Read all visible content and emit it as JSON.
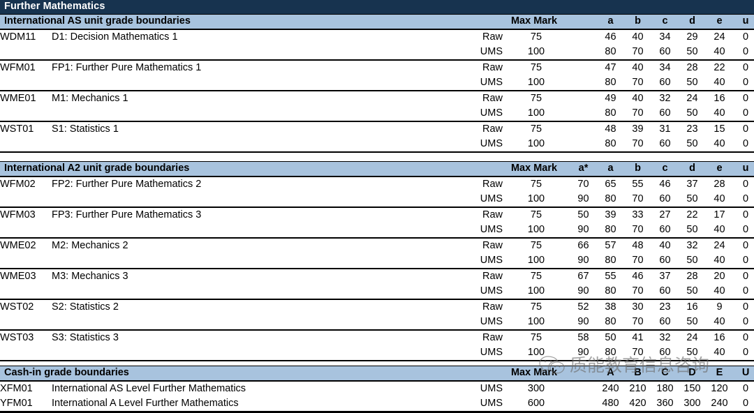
{
  "document": {
    "title": "Further Mathematics"
  },
  "columns": {
    "max_mark": "Max Mark",
    "as_grades": [
      "a",
      "b",
      "c",
      "d",
      "e",
      "u"
    ],
    "a2_grades": [
      "a*",
      "a",
      "b",
      "c",
      "d",
      "e",
      "u"
    ],
    "cashin_grades": [
      "A",
      "B",
      "C",
      "D",
      "E",
      "U"
    ],
    "raw_label": "Raw",
    "ums_label": "UMS"
  },
  "colors": {
    "title_bar": "#17334f",
    "section_bar": "#a8c3de",
    "text": "#000000",
    "watermark": "#6d6d6d"
  },
  "sections": [
    {
      "heading": "International AS unit grade boundaries",
      "units": [
        {
          "code": "WDM11",
          "title": "D1: Decision Mathematics 1",
          "raw": {
            "max": "75",
            "grades": [
              "46",
              "40",
              "34",
              "29",
              "24",
              "0"
            ]
          },
          "ums": {
            "max": "100",
            "grades": [
              "80",
              "70",
              "60",
              "50",
              "40",
              "0"
            ]
          }
        },
        {
          "code": "WFM01",
          "title": "FP1: Further Pure Mathematics 1",
          "raw": {
            "max": "75",
            "grades": [
              "47",
              "40",
              "34",
              "28",
              "22",
              "0"
            ]
          },
          "ums": {
            "max": "100",
            "grades": [
              "80",
              "70",
              "60",
              "50",
              "40",
              "0"
            ]
          }
        },
        {
          "code": "WME01",
          "title": "M1: Mechanics 1",
          "raw": {
            "max": "75",
            "grades": [
              "49",
              "40",
              "32",
              "24",
              "16",
              "0"
            ]
          },
          "ums": {
            "max": "100",
            "grades": [
              "80",
              "70",
              "60",
              "50",
              "40",
              "0"
            ]
          }
        },
        {
          "code": "WST01",
          "title": "S1: Statistics 1",
          "raw": {
            "max": "75",
            "grades": [
              "48",
              "39",
              "31",
              "23",
              "15",
              "0"
            ]
          },
          "ums": {
            "max": "100",
            "grades": [
              "80",
              "70",
              "60",
              "50",
              "40",
              "0"
            ]
          }
        }
      ]
    },
    {
      "heading": "International A2 unit grade boundaries",
      "units": [
        {
          "code": "WFM02",
          "title": "FP2: Further Pure Mathematics 2",
          "raw": {
            "max": "75",
            "grades": [
              "70",
              "65",
              "55",
              "46",
              "37",
              "28",
              "0"
            ]
          },
          "ums": {
            "max": "100",
            "grades": [
              "90",
              "80",
              "70",
              "60",
              "50",
              "40",
              "0"
            ]
          }
        },
        {
          "code": "WFM03",
          "title": "FP3: Further Pure Mathematics 3",
          "raw": {
            "max": "75",
            "grades": [
              "50",
              "39",
              "33",
              "27",
              "22",
              "17",
              "0"
            ]
          },
          "ums": {
            "max": "100",
            "grades": [
              "90",
              "80",
              "70",
              "60",
              "50",
              "40",
              "0"
            ]
          }
        },
        {
          "code": "WME02",
          "title": "M2: Mechanics 2",
          "raw": {
            "max": "75",
            "grades": [
              "66",
              "57",
              "48",
              "40",
              "32",
              "24",
              "0"
            ]
          },
          "ums": {
            "max": "100",
            "grades": [
              "90",
              "80",
              "70",
              "60",
              "50",
              "40",
              "0"
            ]
          }
        },
        {
          "code": "WME03",
          "title": "M3: Mechanics 3",
          "raw": {
            "max": "75",
            "grades": [
              "67",
              "55",
              "46",
              "37",
              "28",
              "20",
              "0"
            ]
          },
          "ums": {
            "max": "100",
            "grades": [
              "90",
              "80",
              "70",
              "60",
              "50",
              "40",
              "0"
            ]
          }
        },
        {
          "code": "WST02",
          "title": "S2: Statistics 2",
          "raw": {
            "max": "75",
            "grades": [
              "52",
              "38",
              "30",
              "23",
              "16",
              "9",
              "0"
            ]
          },
          "ums": {
            "max": "100",
            "grades": [
              "90",
              "80",
              "70",
              "60",
              "50",
              "40",
              "0"
            ]
          }
        },
        {
          "code": "WST03",
          "title": "S3: Statistics 3",
          "raw": {
            "max": "75",
            "grades": [
              "58",
              "50",
              "41",
              "32",
              "24",
              "16",
              "0"
            ]
          },
          "ums": {
            "max": "100",
            "grades": [
              "90",
              "80",
              "70",
              "60",
              "50",
              "40",
              "0"
            ]
          }
        }
      ]
    }
  ],
  "cashin": {
    "heading": "Cash-in grade boundaries",
    "rows": [
      {
        "code": "XFM01",
        "title": "International AS Level Further Mathematics",
        "type": "UMS",
        "max": "300",
        "grades": [
          "240",
          "210",
          "180",
          "150",
          "120",
          "0"
        ]
      },
      {
        "code": "YFM01",
        "title": "International A Level Further Mathematics",
        "type": "UMS",
        "max": "600",
        "grades": [
          "480",
          "420",
          "360",
          "300",
          "240",
          "0"
        ]
      }
    ]
  },
  "watermark": {
    "text": "质能教育信息咨询",
    "icon": "wechat-icon"
  }
}
